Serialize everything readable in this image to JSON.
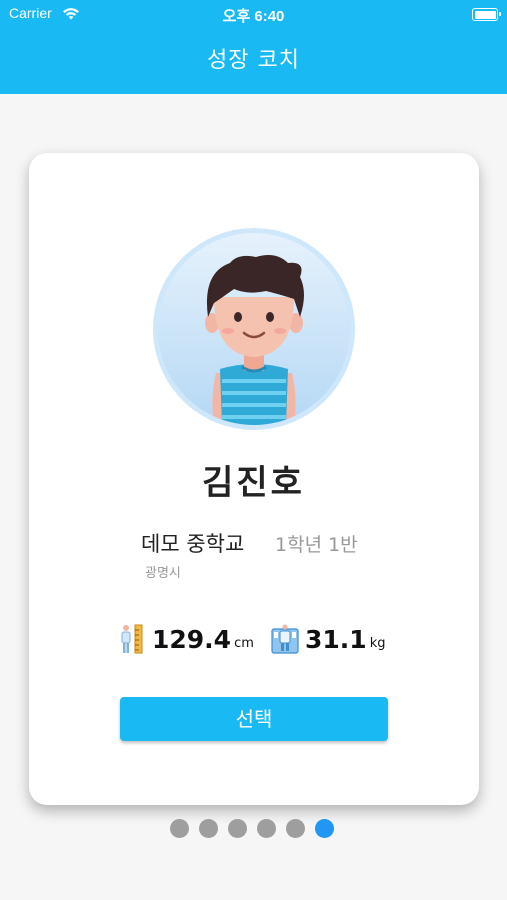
{
  "status_bar": {
    "carrier": "Carrier",
    "time": "오후 6:40"
  },
  "nav": {
    "title": "성장 코치"
  },
  "profile": {
    "name": "김진호",
    "school": "데모 중학교",
    "grade": "1학년 1반",
    "city": "광명시",
    "height_value": "129.4",
    "height_unit": "cm",
    "weight_value": "31.1",
    "weight_unit": "kg",
    "select_label": "선택"
  },
  "pager": {
    "count": 6,
    "active_index": 5
  },
  "colors": {
    "accent": "#19b9f4",
    "active_dot": "#2196f3",
    "inactive_dot": "#9e9e9e"
  },
  "icons": {
    "wifi": "wifi-icon",
    "battery": "battery-icon",
    "height": "height-ruler-icon",
    "weight": "weight-scale-icon",
    "avatar": "boy-avatar"
  }
}
